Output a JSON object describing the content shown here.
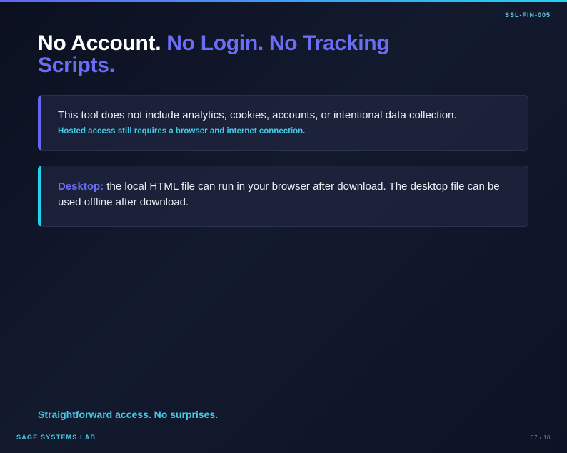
{
  "header": {
    "doc_code": "SSL-FIN-005"
  },
  "title": {
    "part1": "No Account.",
    "part2": "No Login. No Tracking Scripts."
  },
  "privacy_card": {
    "main": "This tool does not include analytics, cookies, accounts, or intentional data collection.",
    "note": "Hosted access still requires a browser and internet connection."
  },
  "desktop_card": {
    "lead": "Desktop:",
    "body": "the local HTML file can run in your browser after download. The desktop file can be used offline after download."
  },
  "tagline": "Straightforward access. No surprises.",
  "footer": {
    "brand": "SAGE SYSTEMS LAB",
    "page": "07 / 10"
  },
  "colors": {
    "accent_indigo": "#6366f1",
    "accent_cyan": "#22d3ee",
    "background": "#0b1020"
  }
}
